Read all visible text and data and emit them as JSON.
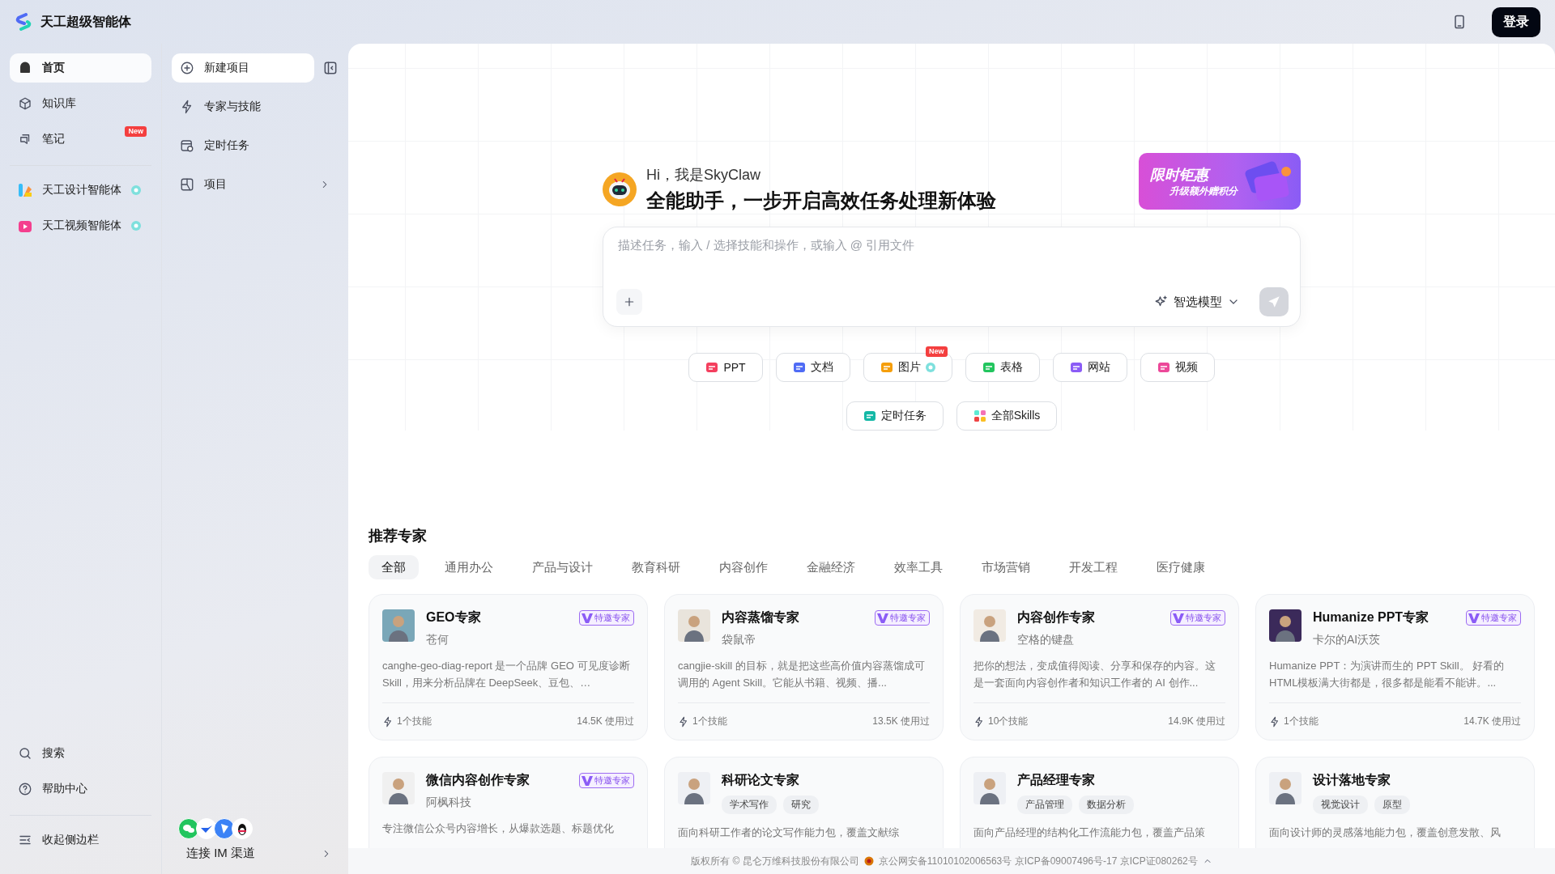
{
  "app": {
    "title": "天工超级智能体"
  },
  "top_bar": {
    "login_button": "登录"
  },
  "sidebar": {
    "items": [
      {
        "label": "首页",
        "selected": true
      },
      {
        "label": "知识库",
        "selected": false
      },
      {
        "label": "笔记",
        "selected": false,
        "badge": "New"
      }
    ],
    "agents": [
      {
        "label": "天工设计智能体",
        "credit": true
      },
      {
        "label": "天工视频智能体",
        "credit": true
      }
    ],
    "bottom_items": [
      {
        "label": "搜索"
      },
      {
        "label": "帮助中心"
      }
    ],
    "collapse": "收起侧边栏"
  },
  "panel": {
    "new_project": "新建项目",
    "items": [
      {
        "label": "专家与技能",
        "kind": "link"
      },
      {
        "label": "定时任务",
        "kind": "link"
      },
      {
        "label": "项目",
        "kind": "folder"
      }
    ],
    "im_link": "连接 IM 渠道"
  },
  "hero": {
    "greeting": "Hi，我是SkyClaw",
    "headline": "全能助手，一步开启高效任务处理新体验",
    "promo": {
      "title": "限时钜惠",
      "subtitle": "升级额外赠积分"
    },
    "input": {
      "placeholder": "描述任务，输入 / 选择技能和操作，或输入 @ 引用文件",
      "model": "智选模型"
    },
    "quick_actions": [
      {
        "label": "PPT",
        "kind": "ppt"
      },
      {
        "label": "文档",
        "kind": "doc"
      },
      {
        "label": "图片",
        "kind": "image",
        "badge": "New",
        "credit": true
      },
      {
        "label": "表格",
        "kind": "sheet"
      },
      {
        "label": "网站",
        "kind": "web"
      },
      {
        "label": "视频",
        "kind": "video"
      }
    ],
    "more_actions": [
      {
        "label": "定时任务",
        "kind": "schedule"
      },
      {
        "label": "全部Skills",
        "kind": "skills"
      }
    ]
  },
  "experts": {
    "title": "推荐专家",
    "tabs": [
      {
        "label": "全部",
        "selected": true
      },
      {
        "label": "通用办公",
        "selected": false
      },
      {
        "label": "产品与设计",
        "selected": false
      },
      {
        "label": "教育科研",
        "selected": false
      },
      {
        "label": "内容创作",
        "selected": false
      },
      {
        "label": "金融经济",
        "selected": false
      },
      {
        "label": "效率工具",
        "selected": false
      },
      {
        "label": "市场营销",
        "selected": false
      },
      {
        "label": "开发工程",
        "selected": false
      },
      {
        "label": "医疗健康",
        "selected": false
      }
    ],
    "cards": [
      {
        "name": "GEO专家",
        "author": "苍何",
        "badge": "特邀专家",
        "description": "canghe-geo-diag-report 是一个品牌 GEO 可见度诊断 Skill，用来分析品牌在 DeepSeek、豆包、…",
        "skills": "1个技能",
        "uses": "14.5K 使用过"
      },
      {
        "name": "内容蒸馏专家",
        "author": "袋鼠帝",
        "badge": "特邀专家",
        "description": "cangjie-skill 的目标，就是把这些高价值内容蒸馏成可调用的 Agent Skill。它能从书籍、视频、播...",
        "skills": "1个技能",
        "uses": "13.5K 使用过"
      },
      {
        "name": "内容创作专家",
        "author": "空格的键盘",
        "badge": "特邀专家",
        "description": "把你的想法，变成值得阅读、分享和保存的内容。这是一套面向内容创作者和知识工作者的 AI 创作...",
        "skills": "10个技能",
        "uses": "14.9K 使用过"
      },
      {
        "name": "Humanize PPT专家",
        "author": "卡尔的AI沃茨",
        "badge": "特邀专家",
        "description": "Humanize PPT：为演讲而生的 PPT Skill。 好看的HTML模板满大街都是，很多都是能看不能讲。...",
        "skills": "1个技能",
        "uses": "14.7K 使用过"
      },
      {
        "name": "微信内容创作专家",
        "author": "阿枫科技",
        "badge": "特邀专家",
        "description": "专注微信公众号内容增长，从爆款选题、标题优化"
      },
      {
        "name": "科研论文专家",
        "tags": [
          "学术写作",
          "研究"
        ],
        "description": "面向科研工作者的论文写作能力包，覆盖文献综"
      },
      {
        "name": "产品经理专家",
        "tags": [
          "产品管理",
          "数据分析"
        ],
        "description": "面向产品经理的结构化工作流能力包，覆盖产品策"
      },
      {
        "name": "设计落地专家",
        "tags": [
          "视觉设计",
          "原型"
        ],
        "description": "面向设计师的灵感落地能力包，覆盖创意发散、风"
      }
    ]
  },
  "footer": {
    "copyright": "版权所有 © 昆仑万维科技股份有限公司",
    "records": "京公网安备11010102006563号 京ICP备09007496号-17 京ICP证080262号"
  }
}
